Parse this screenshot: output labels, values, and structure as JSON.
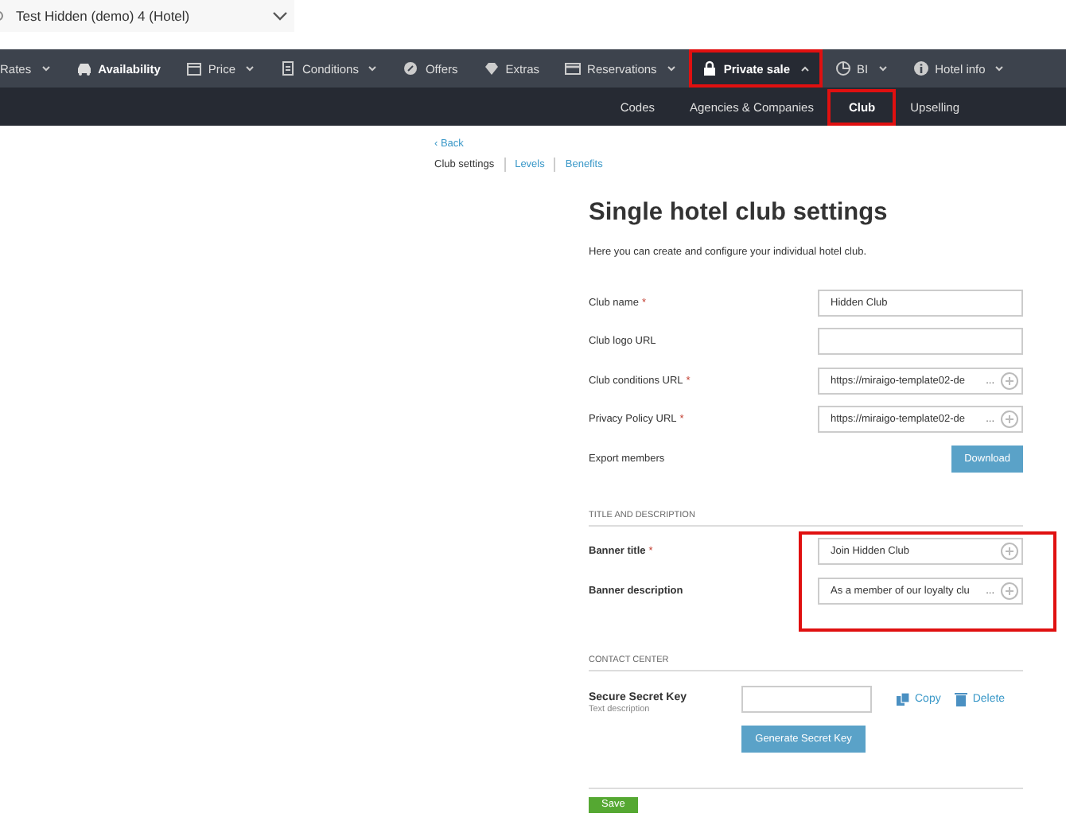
{
  "hotel_selector": {
    "value": "Test Hidden (demo) 4 (Hotel)"
  },
  "nav": [
    {
      "label": "Rates",
      "caret": true,
      "bold": false,
      "selected": false,
      "highlighted": false
    },
    {
      "label": "Availability",
      "caret": false,
      "bold": true,
      "selected": false,
      "highlighted": false
    },
    {
      "label": "Price",
      "caret": true,
      "bold": false,
      "selected": false,
      "highlighted": false
    },
    {
      "label": "Conditions",
      "caret": true,
      "bold": false,
      "selected": false,
      "highlighted": false
    },
    {
      "label": "Offers",
      "caret": false,
      "bold": false,
      "selected": false,
      "highlighted": false
    },
    {
      "label": "Extras",
      "caret": false,
      "bold": false,
      "selected": false,
      "highlighted": false
    },
    {
      "label": "Reservations",
      "caret": true,
      "bold": false,
      "selected": false,
      "highlighted": false
    },
    {
      "label": "Private sale",
      "caret": true,
      "bold": true,
      "selected": true,
      "highlighted": true
    },
    {
      "label": "BI",
      "caret": true,
      "bold": false,
      "selected": false,
      "highlighted": false
    },
    {
      "label": "Hotel info",
      "caret": true,
      "bold": false,
      "selected": false,
      "highlighted": false
    }
  ],
  "subnav": [
    {
      "label": "Codes",
      "selected": false,
      "highlighted": false
    },
    {
      "label": "Agencies & Companies",
      "selected": false,
      "highlighted": false
    },
    {
      "label": "Club",
      "selected": true,
      "highlighted": true
    },
    {
      "label": "Upselling",
      "selected": false,
      "highlighted": false
    }
  ],
  "back_link": "‹ Back",
  "breadcrumbs": [
    {
      "label": "Club settings",
      "selected": true
    },
    {
      "label": "Levels",
      "selected": false
    },
    {
      "label": "Benefits",
      "selected": false
    }
  ],
  "title": "Single hotel club settings",
  "intro": "Here you can create and configure your individual hotel club.",
  "fields": [
    {
      "kind": "input",
      "label": "Club name",
      "required_mark": "*",
      "value": "Hidden Club"
    },
    {
      "kind": "input",
      "label": "Club logo URL"
    },
    {
      "kind": "translatable",
      "label": "Club conditions URL",
      "required_mark": "*",
      "value": "https://miraigo-template02-de",
      "ellipsis": "..."
    },
    {
      "kind": "translatable",
      "label": "Privacy Policy URL",
      "required_mark": "*",
      "value": "https://miraigo-template02-de",
      "ellipsis": "..."
    },
    {
      "kind": "button",
      "label": "Export members",
      "button": "Download"
    }
  ],
  "sections": [
    {
      "heading": "TITLE AND DESCRIPTION",
      "highlighted": true,
      "fields": [
        {
          "kind": "translatable",
          "label": "Banner title",
          "required_mark": "*",
          "value": "Join Hidden Club"
        },
        {
          "kind": "translatable",
          "label": "Banner description",
          "value": "As a member of our loyalty clu",
          "ellipsis": "..."
        }
      ]
    }
  ],
  "contact_center": {
    "heading": "CONTACT CENTER",
    "label": "Secure Secret Key",
    "hint": "Text description",
    "copy": "Copy",
    "delete": "Delete",
    "generate": "Generate Secret Key"
  },
  "save": "Save"
}
